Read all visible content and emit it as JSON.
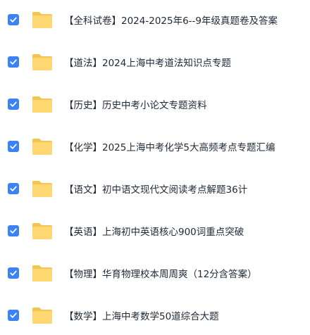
{
  "accent_color": "#3b82f6",
  "folder_color": "#fcd772",
  "files": [
    {
      "name": "【全科试卷】2024-2025年6--9年级真题卷及答案",
      "checked": true,
      "icon": "folder-icon"
    },
    {
      "name": "【道法】2024上海中考道法知识点专题",
      "checked": true,
      "icon": "folder-icon"
    },
    {
      "name": "【历史】历史中考小论文专题资料",
      "checked": true,
      "icon": "folder-icon"
    },
    {
      "name": "【化学】2025上海中考化学5大高频考点专题汇编",
      "checked": true,
      "icon": "folder-icon"
    },
    {
      "name": "【语文】初中语文现代文阅读考点解题36计",
      "checked": true,
      "icon": "folder-icon"
    },
    {
      "name": "【英语】上海初中英语核心900词重点突破",
      "checked": true,
      "icon": "folder-icon"
    },
    {
      "name": "【物理】华育物理校本周周爽（12分含答案）",
      "checked": true,
      "icon": "folder-icon"
    },
    {
      "name": "【数学】上海中考数学50道综合大题",
      "checked": true,
      "icon": "folder-icon"
    }
  ]
}
